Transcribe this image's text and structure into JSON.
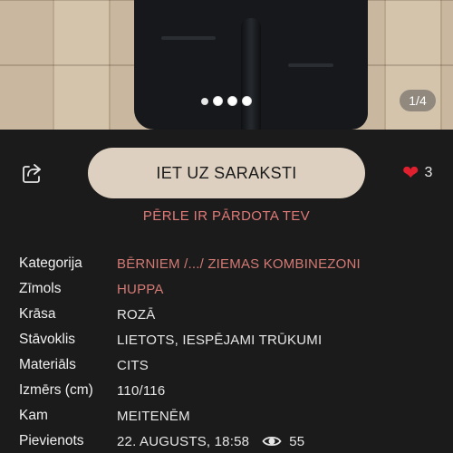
{
  "hero": {
    "counter": "1/4",
    "dots": 3
  },
  "actions": {
    "share_icon": "share-icon",
    "cta_label": "IET UZ SARAKSTI",
    "favorite_icon": "heart-icon",
    "favorite_count": "3",
    "favorite_color": "#e0202f"
  },
  "status": {
    "sold_note": "PĒRLE IR PĀRDOTA TEV",
    "accent": "#e07a78"
  },
  "details": [
    {
      "label": "Kategorija",
      "value": "BĒRNIEM /.../ ZIEMAS KOMBINEZONI"
    },
    {
      "label": "Zīmols",
      "value": "HUPPA"
    },
    {
      "label": "Krāsa",
      "value": "ROZĀ"
    },
    {
      "label": "Stāvoklis",
      "value": "LIETOTS, IESPĒJAMI TRŪKUMI"
    },
    {
      "label": "Materiāls",
      "value": "CITS"
    },
    {
      "label": "Izmērs (cm)",
      "value": "110/116"
    },
    {
      "label": "Kam",
      "value": "MEITENĒM"
    },
    {
      "label": "Pievienots",
      "value": "22. AUGUSTS, 18:58",
      "views": "55",
      "views_icon": "eye-icon"
    }
  ]
}
